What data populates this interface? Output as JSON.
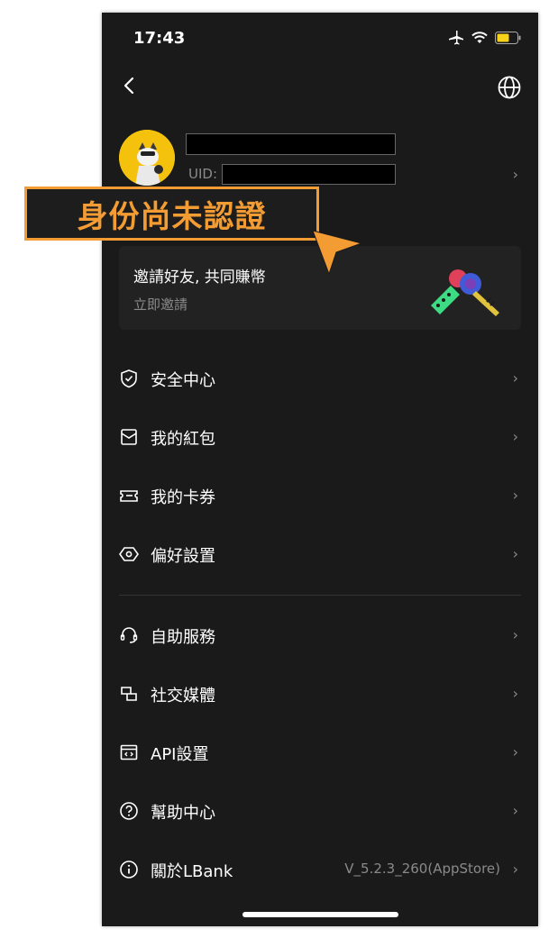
{
  "status_bar": {
    "time": "17:43"
  },
  "profile": {
    "uid_label": "UID:"
  },
  "annotation": {
    "text": "身份尚未認證"
  },
  "invite": {
    "title": "邀請好友, 共同賺幣",
    "subtitle": "立即邀請"
  },
  "menu_section_1": [
    {
      "label": "安全中心",
      "icon": "shield-icon"
    },
    {
      "label": "我的紅包",
      "icon": "red-envelope-icon"
    },
    {
      "label": "我的卡券",
      "icon": "ticket-icon"
    },
    {
      "label": "偏好設置",
      "icon": "preferences-icon"
    }
  ],
  "menu_section_2": [
    {
      "label": "自助服務",
      "icon": "headset-icon"
    },
    {
      "label": "社交媒體",
      "icon": "social-media-icon"
    },
    {
      "label": "API設置",
      "icon": "api-icon"
    },
    {
      "label": "幫助中心",
      "icon": "help-icon"
    },
    {
      "label": "關於LBank",
      "icon": "info-icon",
      "version": "V_5.2.3_260(AppStore)"
    }
  ],
  "colors": {
    "background": "#1a1a1a",
    "accent_orange": "#f39c34",
    "muted_text": "#8a8a8a"
  }
}
